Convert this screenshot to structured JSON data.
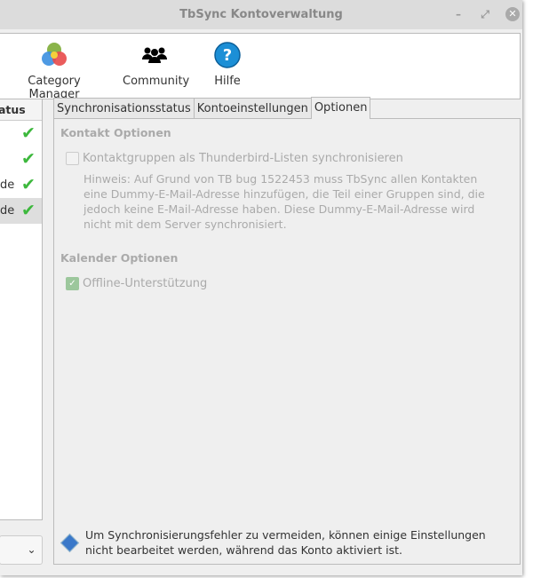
{
  "window": {
    "title": "TbSync Kontoverwaltung"
  },
  "toolbar": {
    "items": [
      {
        "label": "Category Manager"
      },
      {
        "label": "Community"
      },
      {
        "label": "Hilfe"
      }
    ]
  },
  "accounts": {
    "header": "tatus",
    "rows": [
      {
        "label": ""
      },
      {
        "label": ""
      },
      {
        "label": "de"
      },
      {
        "label": "de"
      }
    ]
  },
  "tabs": [
    {
      "label": "Synchronisationsstatus"
    },
    {
      "label": "Kontoeinstellungen"
    },
    {
      "label": "Optionen"
    }
  ],
  "options": {
    "contact_heading": "Kontakt Optionen",
    "contact_groups_label": "Kontaktgruppen als Thunderbird-Listen synchronisieren",
    "hint": "Hinweis: Auf Grund von TB bug 1522453 muss TbSync allen Kontakten eine Dummy-E-Mail-Adresse hinzufügen, die Teil einer Gruppen sind, die jedoch keine E-Mail-Adresse haben. Diese Dummy-E-Mail-Adresse wird nicht mit dem Server synchronisiert.",
    "calendar_heading": "Kalender Optionen",
    "offline_label": "Offline-Unterstützung"
  },
  "info": "Um Synchronisierungsfehler zu vermeiden, können einige Einstellungen nicht bearbeitet werden, während das Konto aktiviert ist."
}
